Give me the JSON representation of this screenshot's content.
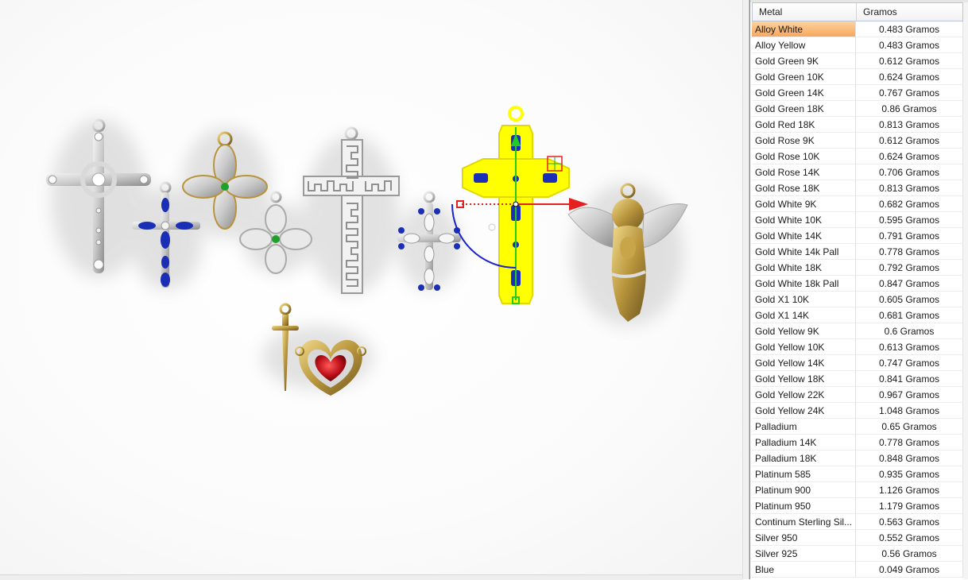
{
  "table": {
    "columns": [
      "Metal",
      "Gramos"
    ],
    "selected_index": 0,
    "rows": [
      {
        "metal": "Alloy White",
        "gramos": "0.483 Gramos"
      },
      {
        "metal": "Alloy Yellow",
        "gramos": "0.483 Gramos"
      },
      {
        "metal": "Gold Green 9K",
        "gramos": "0.612 Gramos"
      },
      {
        "metal": "Gold Green 10K",
        "gramos": "0.624 Gramos"
      },
      {
        "metal": "Gold Green 14K",
        "gramos": "0.767 Gramos"
      },
      {
        "metal": "Gold Green 18K",
        "gramos": "0.86 Gramos"
      },
      {
        "metal": "Gold Red 18K",
        "gramos": "0.813 Gramos"
      },
      {
        "metal": "Gold Rose 9K",
        "gramos": "0.612 Gramos"
      },
      {
        "metal": "Gold Rose 10K",
        "gramos": "0.624 Gramos"
      },
      {
        "metal": "Gold Rose 14K",
        "gramos": "0.706 Gramos"
      },
      {
        "metal": "Gold Rose 18K",
        "gramos": "0.813 Gramos"
      },
      {
        "metal": "Gold White 9K",
        "gramos": "0.682 Gramos"
      },
      {
        "metal": "Gold White 10K",
        "gramos": "0.595 Gramos"
      },
      {
        "metal": "Gold White 14K",
        "gramos": "0.791 Gramos"
      },
      {
        "metal": "Gold White 14k Pall",
        "gramos": "0.778 Gramos"
      },
      {
        "metal": "Gold White 18K",
        "gramos": "0.792 Gramos"
      },
      {
        "metal": "Gold White 18k Pall",
        "gramos": "0.847 Gramos"
      },
      {
        "metal": "Gold X1 10K",
        "gramos": "0.605 Gramos"
      },
      {
        "metal": "Gold X1 14K",
        "gramos": "0.681 Gramos"
      },
      {
        "metal": "Gold Yellow 9K",
        "gramos": "0.6 Gramos"
      },
      {
        "metal": "Gold Yellow 10K",
        "gramos": "0.613 Gramos"
      },
      {
        "metal": "Gold Yellow 14K",
        "gramos": "0.747 Gramos"
      },
      {
        "metal": "Gold Yellow 18K",
        "gramos": "0.841 Gramos"
      },
      {
        "metal": "Gold Yellow 22K",
        "gramos": "0.967 Gramos"
      },
      {
        "metal": "Gold Yellow 24K",
        "gramos": "1.048 Gramos"
      },
      {
        "metal": "Palladium",
        "gramos": "0.65 Gramos"
      },
      {
        "metal": "Palladium 14K",
        "gramos": "0.778 Gramos"
      },
      {
        "metal": "Palladium 18K",
        "gramos": "0.848 Gramos"
      },
      {
        "metal": "Platinum 585",
        "gramos": "0.935 Gramos"
      },
      {
        "metal": "Platinum 900",
        "gramos": "1.126 Gramos"
      },
      {
        "metal": "Platinum 950",
        "gramos": "1.179 Gramos"
      },
      {
        "metal": "Continum Sterling Sil...",
        "gramos": "0.563 Gramos"
      },
      {
        "metal": "Silver 950",
        "gramos": "0.552 Gramos"
      },
      {
        "metal": "Silver 925",
        "gramos": "0.56 Gramos"
      },
      {
        "metal": "Blue",
        "gramos": "0.049 Gramos"
      }
    ]
  },
  "colors": {
    "selection_highlight": "#f7a75c",
    "selected_object": "#ffff00",
    "gizmo_x_axis": "#e52020",
    "gizmo_y_axis": "#22cc22",
    "gizmo_rotate": "#1a22cc",
    "gem_sapphire": "#1a2fb5",
    "gem_emerald": "#1fa02a",
    "gem_ruby": "#c0121a"
  }
}
